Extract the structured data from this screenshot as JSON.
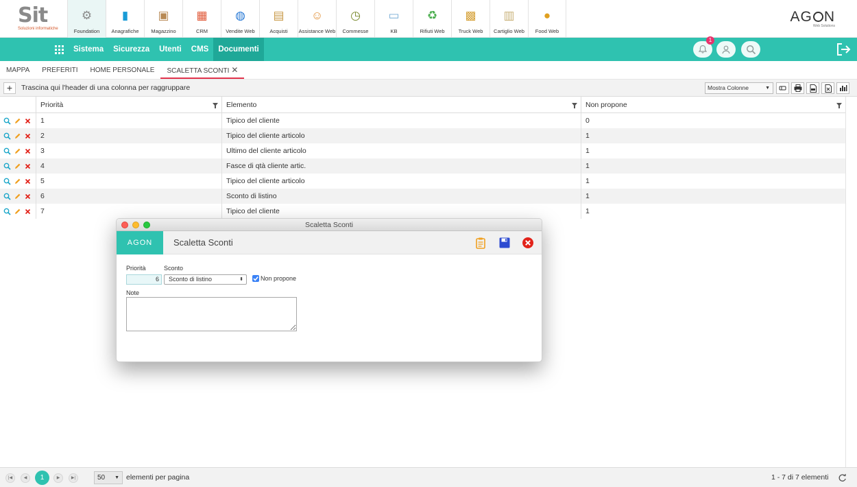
{
  "brand": {
    "logo_text": "Sit",
    "logo_sub": "Soluzioni informatiche",
    "agon_name_pre": "AG",
    "agon_name_post": "N",
    "agon_sub": "Web Solutions"
  },
  "modules": [
    {
      "label": "Foundation",
      "icon": "gear-icon",
      "color": "#8a8a8a",
      "active": true
    },
    {
      "label": "Anagrafiche",
      "icon": "book-icon",
      "color": "#1a9bd6"
    },
    {
      "label": "Magazzino",
      "icon": "box-icon",
      "color": "#b88a55"
    },
    {
      "label": "CRM",
      "icon": "calendar-icon",
      "color": "#e05a3a"
    },
    {
      "label": "Vendite Web",
      "icon": "globe-icon",
      "color": "#2b7bd6"
    },
    {
      "label": "Acquisti",
      "icon": "clipboard-icon",
      "color": "#c99a4a"
    },
    {
      "label": "Assistance Web",
      "icon": "support-icon",
      "color": "#e08b2e"
    },
    {
      "label": "Commesse",
      "icon": "clock-icon",
      "color": "#7a8a2e"
    },
    {
      "label": "KB",
      "icon": "screen-icon",
      "color": "#7aaed6"
    },
    {
      "label": "Rifiuti Web",
      "icon": "recycle-icon",
      "color": "#4caf50"
    },
    {
      "label": "Truck Web",
      "icon": "truck-box-icon",
      "color": "#d6a23a"
    },
    {
      "label": "Cartiglio Web",
      "icon": "document-icon",
      "color": "#c9b27a"
    },
    {
      "label": "Food Web",
      "icon": "fruit-icon",
      "color": "#e0a020"
    }
  ],
  "nav": {
    "items": [
      {
        "label": "Sistema"
      },
      {
        "label": "Sicurezza"
      },
      {
        "label": "Utenti"
      },
      {
        "label": "CMS"
      },
      {
        "label": "Documenti",
        "active": true
      }
    ],
    "notification_count": "1"
  },
  "tabs": [
    {
      "label": "MAPPA"
    },
    {
      "label": "PREFERITI"
    },
    {
      "label": "HOME PERSONALE"
    },
    {
      "label": "SCALETTA SCONTI",
      "active": true,
      "closable": true
    }
  ],
  "groupbar": {
    "add_label": "+",
    "hint": "Trascina qui l'header di una colonna per raggruppare",
    "columns_select": "Mostra Colonne"
  },
  "table": {
    "columns": [
      "Priorità",
      "Elemento",
      "Non propone"
    ],
    "rows": [
      [
        "1",
        "Tipico del cliente",
        "0"
      ],
      [
        "2",
        "Tipico del cliente articolo",
        "1"
      ],
      [
        "3",
        "Ultimo del cliente articolo",
        "1"
      ],
      [
        "4",
        "Fasce di qtà cliente artic.",
        "1"
      ],
      [
        "5",
        "Tipico del cliente articolo",
        "1"
      ],
      [
        "6",
        "Sconto di listino",
        "1"
      ],
      [
        "7",
        "Tipico del cliente",
        "1"
      ]
    ]
  },
  "footer": {
    "current_page": "1",
    "page_size": "50",
    "page_size_label": "elementi per pagina",
    "range": "1 - 7 di 7 elementi"
  },
  "modal": {
    "window_title": "Scaletta Sconti",
    "logo": "AGON",
    "heading": "Scaletta Sconti",
    "priorita_label": "Priorità",
    "priorita_value": "6",
    "sconto_label": "Sconto",
    "sconto_value": "Sconto di listino",
    "non_propone_label": "Non propone",
    "non_propone_checked": true,
    "note_label": "Note",
    "note_value": ""
  },
  "colors": {
    "accent": "#2fc2b0",
    "nav_active": "#1fa898",
    "tab_underline": "#e1334c",
    "badge": "#e8336d",
    "save_icon": "#2d4bd1",
    "close_icon": "#e2231a",
    "clipboard_icon": "#f0a020"
  }
}
